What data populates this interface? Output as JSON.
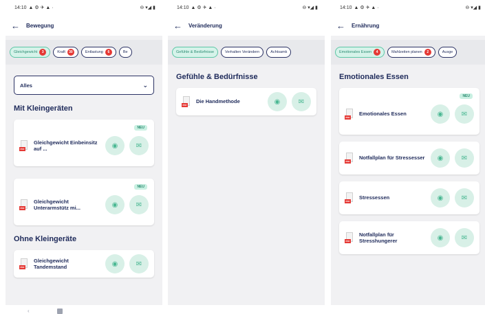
{
  "status": {
    "time": "14:10"
  },
  "screens": [
    {
      "title": "Bewegung",
      "chips": [
        {
          "label": "Gleichgewicht",
          "badge": "3",
          "active": true
        },
        {
          "label": "Kraft",
          "badge": "30",
          "active": false
        },
        {
          "label": "Entlastung",
          "badge": "6",
          "active": false
        },
        {
          "label": "Be",
          "badge": "",
          "active": false
        }
      ],
      "dropdown": "Alles",
      "section1": "Mit Kleingeräten",
      "section1_items": [
        {
          "title": "Gleichgewicht Einbeinsitz auf ...",
          "new": "NEU"
        },
        {
          "title": "Gleichgewicht Unterarmstütz mi...",
          "new": "NEU"
        }
      ],
      "section2": "Ohne Kleingeräte",
      "section2_items": [
        {
          "title": "Gleichgewicht Tandemstand"
        }
      ]
    },
    {
      "title": "Veränderung",
      "chips": [
        {
          "label": "Gefühle & Bedürfnisse",
          "badge": "",
          "active": true
        },
        {
          "label": "Verhalten Verändern",
          "badge": "",
          "active": false
        },
        {
          "label": "Achtsamk",
          "badge": "",
          "active": false
        }
      ],
      "section1": "Gefühle & Bedürfnisse",
      "items": [
        {
          "title": "Die Handmethode"
        }
      ]
    },
    {
      "title": "Ernährung",
      "chips": [
        {
          "label": "Emotionales Essen",
          "badge": "4",
          "active": true
        },
        {
          "label": "Mahlzeiten planen",
          "badge": "2",
          "active": false
        },
        {
          "label": "Ausge",
          "badge": "",
          "active": false
        }
      ],
      "section1": "Emotionales Essen",
      "items": [
        {
          "title": "Emotionales Essen",
          "new": "NEU"
        },
        {
          "title": "Notfallplan für Stressesser"
        },
        {
          "title": "Stressessen"
        },
        {
          "title": "Notfallplan für Stresshungerer"
        }
      ]
    }
  ],
  "colors": {
    "accent": "#5cc6a5",
    "navy": "#1e2a5a",
    "badge": "#e53935",
    "pdf": "#e53935"
  },
  "icons": {
    "back": "arrow-left-icon",
    "view": "eye-icon",
    "send": "send-icon",
    "pdf": "pdf-file-icon",
    "chevron": "chevron-down-icon"
  }
}
